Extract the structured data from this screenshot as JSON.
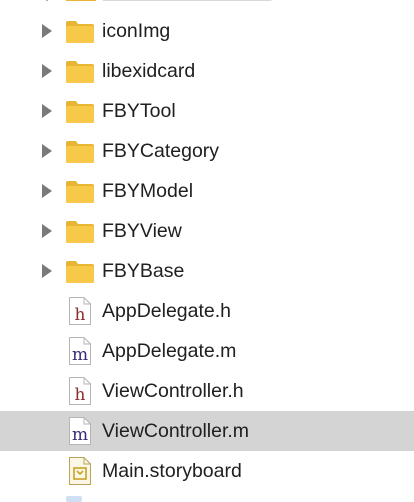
{
  "navigator": {
    "items": [
      {
        "label": "iconImg",
        "kind": "folder",
        "expandable": true,
        "selected": false,
        "icon": "folder-icon"
      },
      {
        "label": "libexidcard",
        "kind": "folder",
        "expandable": true,
        "selected": false,
        "icon": "folder-icon"
      },
      {
        "label": "FBYTool",
        "kind": "folder",
        "expandable": true,
        "selected": false,
        "icon": "folder-icon"
      },
      {
        "label": "FBYCategory",
        "kind": "folder",
        "expandable": true,
        "selected": false,
        "icon": "folder-icon"
      },
      {
        "label": "FBYModel",
        "kind": "folder",
        "expandable": true,
        "selected": false,
        "icon": "folder-icon"
      },
      {
        "label": "FBYView",
        "kind": "folder",
        "expandable": true,
        "selected": false,
        "icon": "folder-icon"
      },
      {
        "label": "FBYBase",
        "kind": "folder",
        "expandable": true,
        "selected": false,
        "icon": "folder-icon"
      },
      {
        "label": "AppDelegate.h",
        "kind": "header",
        "expandable": false,
        "selected": false,
        "icon": "header-file-icon",
        "glyph": "h"
      },
      {
        "label": "AppDelegate.m",
        "kind": "impl",
        "expandable": false,
        "selected": false,
        "icon": "implementation-file-icon",
        "glyph": "m"
      },
      {
        "label": "ViewController.h",
        "kind": "header",
        "expandable": false,
        "selected": false,
        "icon": "header-file-icon",
        "glyph": "h"
      },
      {
        "label": "ViewController.m",
        "kind": "impl",
        "expandable": false,
        "selected": true,
        "icon": "implementation-file-icon",
        "glyph": "m"
      },
      {
        "label": "Main.storyboard",
        "kind": "storyboard",
        "expandable": false,
        "selected": false,
        "icon": "storyboard-file-icon"
      }
    ]
  },
  "colors": {
    "folder": "#f7c948",
    "folder_tab": "#e8b534",
    "header_glyph": "#8b2d2d",
    "impl_glyph": "#3c2a78",
    "selection": "#d4d4d4",
    "disclosure": "#7a7a7a"
  }
}
